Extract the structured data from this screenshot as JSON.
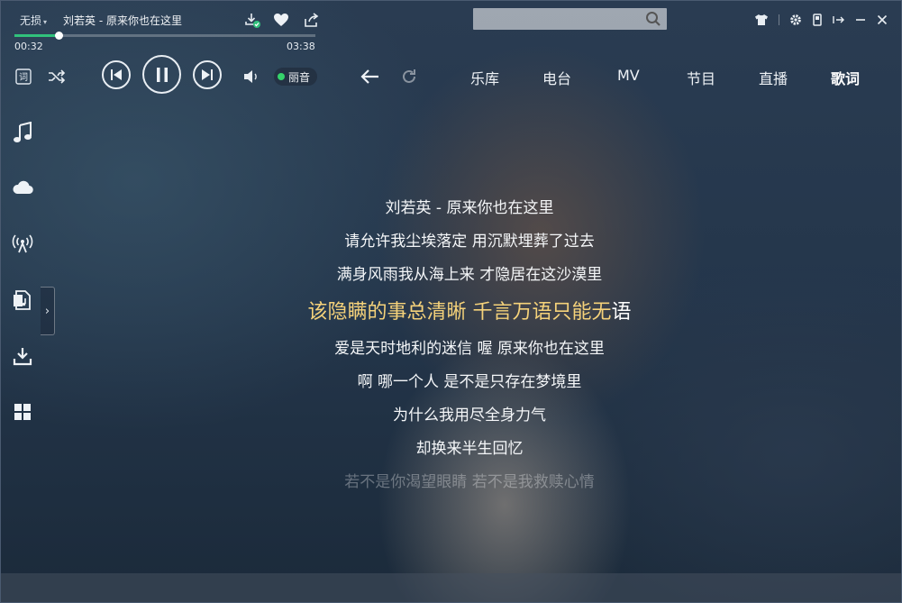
{
  "header": {
    "quality_label": "无损",
    "song_title": "刘若英 - 原来你也在这里"
  },
  "search": {
    "value": "",
    "placeholder": ""
  },
  "player": {
    "current_time": "00:32",
    "total_time": "03:38",
    "progress": 0.147,
    "sound_effect_label": "丽音"
  },
  "nav": {
    "tabs": [
      {
        "label": "乐库",
        "active": false
      },
      {
        "label": "电台",
        "active": false
      },
      {
        "label": "MV",
        "active": false
      },
      {
        "label": "节目",
        "active": false
      },
      {
        "label": "直播",
        "active": false
      },
      {
        "label": "歌词",
        "active": true
      }
    ]
  },
  "sidebar": {
    "items": [
      {
        "icon": "music-note-icon"
      },
      {
        "icon": "cloud-icon"
      },
      {
        "icon": "radio-icon"
      },
      {
        "icon": "playlist-icon"
      },
      {
        "icon": "download-icon"
      },
      {
        "icon": "apps-grid-icon"
      }
    ],
    "expander_glyph": "›"
  },
  "lyrics": {
    "lines": [
      "刘若英 - 原来你也在这里",
      "请允许我尘埃落定 用沉默埋葬了过去",
      "满身风雨我从海上来 才隐居在这沙漠里",
      "该隐瞒的事总清晰 千言万语只能无语",
      "爱是天时地利的迷信 喔 原来你也在这里",
      "啊 哪一个人 是不是只存在梦境里",
      "为什么我用尽全身力气",
      "却换来半生回忆",
      "若不是你渴望眼睛 若不是我救赎心情"
    ],
    "current_index": 3,
    "current_highlighted": "该隐瞒的事总清晰 千言万语只能无",
    "current_rest": "语",
    "highlight_color": "#f5d27a"
  },
  "colors": {
    "accent_green": "#31c27c",
    "quality_dot": "#35d36b"
  }
}
